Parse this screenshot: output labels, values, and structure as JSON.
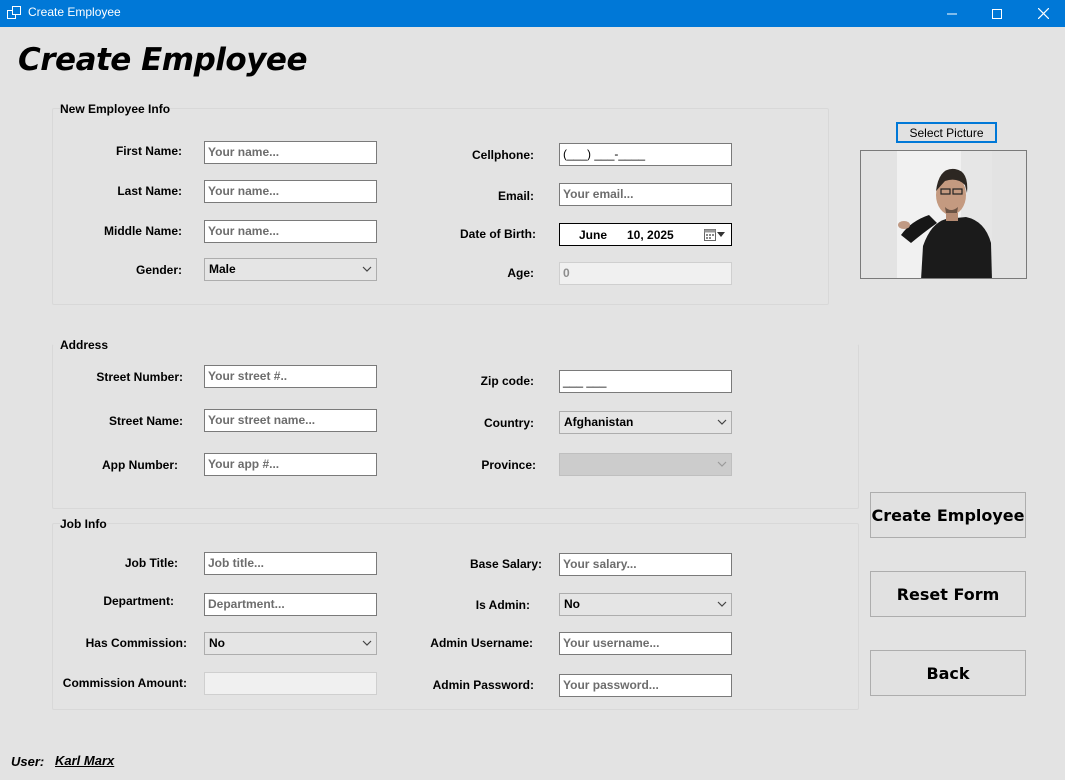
{
  "window": {
    "title": "Create Employee"
  },
  "page_title": "Create Employee",
  "new_employee_info": {
    "title": "New Employee Info",
    "first_name": {
      "label": "First Name:",
      "placeholder": "Your name..."
    },
    "last_name": {
      "label": "Last Name:",
      "placeholder": "Your name..."
    },
    "middle_name": {
      "label": "Middle Name:",
      "placeholder": "Your name..."
    },
    "gender": {
      "label": "Gender:",
      "value": "Male"
    },
    "cellphone": {
      "label": "Cellphone:",
      "mask": "(___) ___-____"
    },
    "email": {
      "label": "Email:",
      "placeholder": "Your email..."
    },
    "date_of_birth": {
      "label": "Date of Birth:",
      "month": "June",
      "day_year": "10, 2025"
    },
    "age": {
      "label": "Age:",
      "value": "0"
    }
  },
  "picture": {
    "button_label": "Select Picture"
  },
  "address": {
    "title": "Address",
    "street_number": {
      "label": "Street Number:",
      "placeholder": "Your street #.."
    },
    "street_name": {
      "label": "Street Name:",
      "placeholder": "Your street name..."
    },
    "app_number": {
      "label": "App Number:",
      "placeholder": "Your app #..."
    },
    "zip_code": {
      "label": "Zip code:",
      "mask": "___ ___"
    },
    "country": {
      "label": "Country:",
      "value": "Afghanistan"
    },
    "province": {
      "label": "Province:",
      "value": ""
    }
  },
  "job_info": {
    "title": "Job Info",
    "job_title": {
      "label": "Job Title:",
      "placeholder": "Job title..."
    },
    "department": {
      "label": "Department:",
      "placeholder": "Department..."
    },
    "has_commission": {
      "label": "Has Commission:",
      "value": "No"
    },
    "commission_amount": {
      "label": "Commission Amount:",
      "value": ""
    },
    "base_salary": {
      "label": "Base Salary:",
      "placeholder": "Your salary..."
    },
    "is_admin": {
      "label": "Is Admin:",
      "value": "No"
    },
    "admin_username": {
      "label": "Admin Username:",
      "placeholder": "Your username..."
    },
    "admin_password": {
      "label": "Admin Password:",
      "placeholder": "Your password..."
    }
  },
  "actions": {
    "create_label": "Create Employee",
    "reset_label": "Reset Form",
    "back_label": "Back"
  },
  "footer": {
    "user_label": "User:",
    "user_name": "Karl Marx"
  }
}
